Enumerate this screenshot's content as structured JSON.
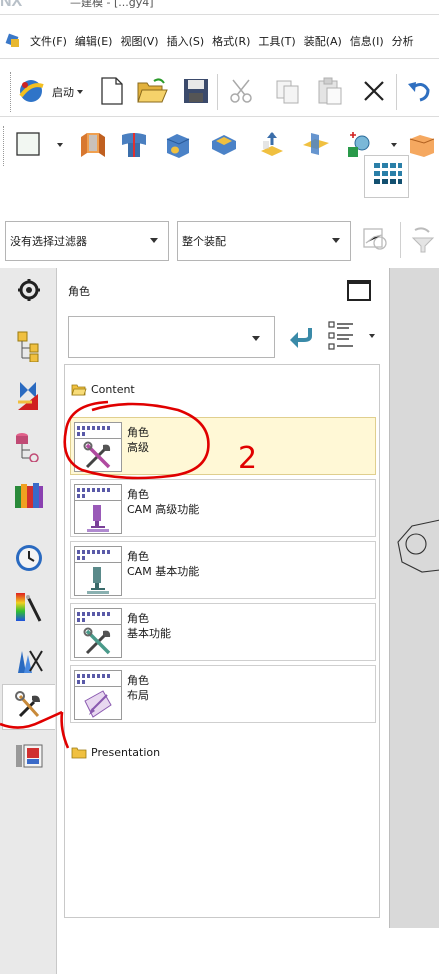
{
  "app": {
    "logo": "NX",
    "title_fragment": "—建模 - [...gy4]"
  },
  "menubar": {
    "items": [
      "文件(F)",
      "编辑(E)",
      "视图(V)",
      "插入(S)",
      "格式(R)",
      "工具(T)",
      "装配(A)",
      "信息(I)",
      "分析"
    ]
  },
  "standard_toolbar": {
    "start_label": "启动",
    "buttons": [
      "new-icon",
      "open-icon",
      "save-icon",
      "cut-icon",
      "copy-icon",
      "paste-icon",
      "delete-icon",
      "undo-icon"
    ]
  },
  "feature_toolbar": {
    "buttons": [
      "sketch-icon",
      "extrude-icon",
      "revolve-icon",
      "hole-icon",
      "shell-icon",
      "offset-face-icon",
      "datum-plane-icon",
      "point-icon",
      "block-icon"
    ]
  },
  "selection_bar": {
    "type_filter": "没有选择过滤器",
    "scope": "整个装配"
  },
  "resource_bar": {
    "tabs": [
      "settings-icon",
      "assembly-navigator-icon",
      "constraint-navigator-icon",
      "part-navigator-icon",
      "reuse-library-icon",
      "history-icon",
      "visualization-icon",
      "process-studio-icon",
      "roles-icon",
      "web-browser-icon"
    ],
    "active": "roles-icon"
  },
  "roles_panel": {
    "title": "角色",
    "selector_value": "",
    "folders": [
      {
        "name": "Content",
        "roles": [
          {
            "name": "角色",
            "desc": "高级",
            "icon": "tools-icon",
            "selected": true
          },
          {
            "name": "角色",
            "desc": "CAM 高级功能",
            "icon": "cam-advanced-icon",
            "selected": false
          },
          {
            "name": "角色",
            "desc": "CAM 基本功能",
            "icon": "cam-basic-icon",
            "selected": false
          },
          {
            "name": "角色",
            "desc": "基本功能",
            "icon": "tools-icon",
            "selected": false
          },
          {
            "name": "角色",
            "desc": "布局",
            "icon": "layout-icon",
            "selected": false
          }
        ]
      },
      {
        "name": "Presentation",
        "roles": []
      }
    ]
  },
  "annotations": {
    "handwritten_number": "2",
    "color": "#e00000"
  }
}
